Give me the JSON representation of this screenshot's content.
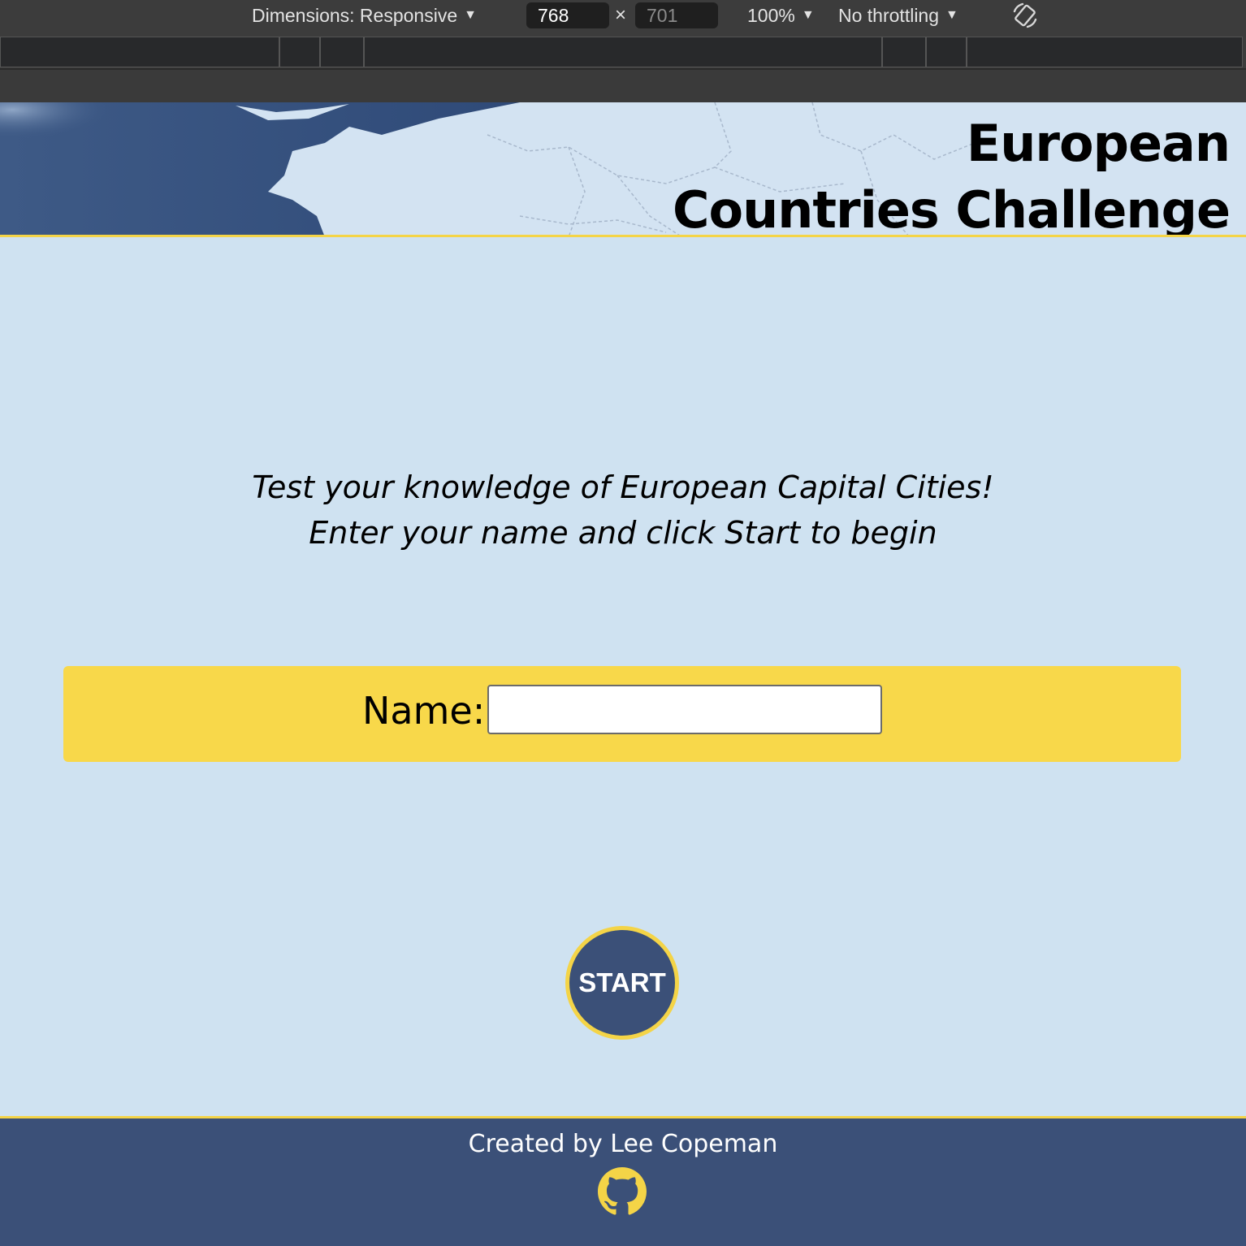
{
  "devtools": {
    "dimensions_label": "Dimensions: Responsive",
    "width_value": "768",
    "times_symbol": "×",
    "height_value": "701",
    "zoom_label": "100%",
    "throttle_label": "No throttling",
    "caret": "▼",
    "rotate_icon": "rotate-icon"
  },
  "header": {
    "title_line1": "European",
    "title_line2": "Countries Challenge"
  },
  "intro": {
    "line1": "Test your knowledge of European Capital Cities!",
    "line2": "Enter your name and click Start to begin"
  },
  "form": {
    "name_label": "Name:",
    "name_value": ""
  },
  "start_button": {
    "label": "START"
  },
  "footer": {
    "credit": "Created by Lee Copeman",
    "icon": "github-icon"
  },
  "colors": {
    "page_background": "#cfe2f1",
    "accent_yellow": "#f8d84a",
    "navy": "#3b5078"
  }
}
